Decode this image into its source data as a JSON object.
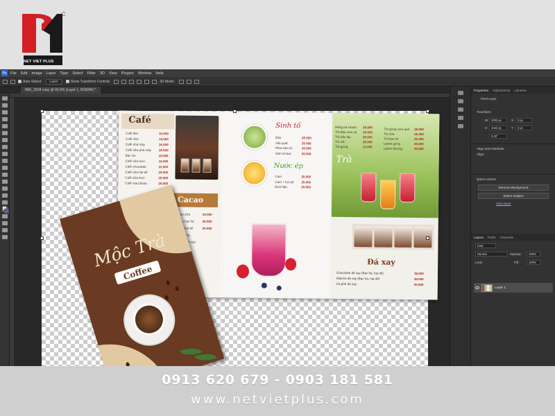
{
  "brand": {
    "logo_text": "NET VIET PLUS",
    "registered": "®",
    "colors": {
      "red": "#d21f26",
      "dark": "#1a1a1a"
    }
  },
  "photoshop": {
    "app_badge": "Ps",
    "menus": [
      "File",
      "Edit",
      "Image",
      "Layer",
      "Type",
      "Select",
      "Filter",
      "3D",
      "View",
      "Plugins",
      "Window",
      "Help"
    ],
    "options": {
      "auto_select": "Auto-Select:",
      "auto_select_value": "Layer",
      "show_transform": "Show Transform Controls",
      "mode_3d": "3D Mode:"
    },
    "document_tab": "IMG_2528 copy @ 66.6% (Layer 1, RGB/8#) *",
    "properties": {
      "tabs": [
        "Properties",
        "Adjustments",
        "Libraries"
      ],
      "kind": "Pixel Layer",
      "transform_title": "Transform",
      "w_label": "W",
      "w_value": "2000 px",
      "h_label": "H",
      "h_value": "1542 px",
      "x_label": "X",
      "x_value": "0 px",
      "y_label": "Y",
      "y_value": "0 px",
      "angle_value": "0.00°",
      "align_title": "Align and Distribute",
      "align_sub": "Align:",
      "quick_title": "Quick Actions",
      "btn_remove_bg": "Remove Background",
      "btn_select_subject": "Select Subject",
      "link_view_more": "View More"
    },
    "layers": {
      "tabs": [
        "Layers",
        "Paths",
        "Channels"
      ],
      "kind": "Kind",
      "blend": "Normal",
      "opacity_label": "Opacity:",
      "opacity_value": "100%",
      "lock_label": "Lock:",
      "fill_label": "Fill:",
      "fill_value": "100%",
      "layer_name": "Layer 1"
    }
  },
  "menu": {
    "cafe_title": "Café",
    "cafe_items": [
      {
        "name": "Cafê đen",
        "price": "15.000"
      },
      {
        "name": "Cafê sữa",
        "price": "18.000"
      },
      {
        "name": "Cafê nhà máy",
        "price": "16.000"
      },
      {
        "name": "Cafê sữa phá máy",
        "price": "16.000"
      },
      {
        "name": "Bạc xỉu",
        "price": "20.000"
      },
      {
        "name": "Cafê sữa tươi",
        "price": "18.000"
      },
      {
        "name": "Cafê chocolate",
        "price": "22.000"
      },
      {
        "name": "Cafê sữa hạt dẻ",
        "price": "25.000"
      },
      {
        "name": "Cafê sữa kem",
        "price": "25.000"
      },
      {
        "name": "Cafê macchiato",
        "price": "25.000"
      }
    ],
    "cacao_title": "Cacao",
    "cacao_items": [
      {
        "name": "Cacao sữa",
        "price": "20.000"
      },
      {
        "name": "Cacao bạc hà",
        "price": "20.000"
      },
      {
        "name": "Cacao hạt dẻ",
        "price": "20.000"
      },
      {
        "name": "Cacao sữa",
        "price": ""
      },
      {
        "name": "Cacao phô mai",
        "price": ""
      }
    ],
    "sinh_to_title": "Sinh tố",
    "sinh_to_items": [
      {
        "name": "Dâu",
        "price": "25.000"
      },
      {
        "name": "Việt quất",
        "price": "25.000"
      },
      {
        "name": "Phúc bồn tử",
        "price": "25.000"
      },
      {
        "name": "Sinh tố kiwi",
        "price": "25.000"
      }
    ],
    "nuoc_ep_title": "Nước ép",
    "nuoc_ep_items": [
      {
        "name": "Cam",
        "price": "25.000"
      },
      {
        "name": "Cam + Cà rốt",
        "price": "25.000"
      },
      {
        "name": "Dưa hấu",
        "price": "25.000"
      }
    ],
    "tra_title": "Trà",
    "tra_items_left": [
      {
        "name": "Hồng trà chanh",
        "price": "20.000"
      },
      {
        "name": "Trà đào cam sả",
        "price": "25.000"
      },
      {
        "name": "Trà dâu tây",
        "price": "25.000"
      },
      {
        "name": "Trà vải",
        "price": "20.000"
      },
      {
        "name": "Trà gừng",
        "price": "12.000"
      }
    ],
    "tra_items_right": [
      {
        "name": "Trà gừng cam quế",
        "price": "25.000"
      },
      {
        "name": "Trà sữa",
        "price": "25.000"
      },
      {
        "name": "Trà bạc hà",
        "price": "25.000"
      },
      {
        "name": "Lipton gừng",
        "price": "25.000"
      },
      {
        "name": "Lipton đường",
        "price": "25.000"
      }
    ],
    "daxay_title": "Đá xay",
    "daxay_items": [
      {
        "name": "Chocolate đá xay (Bạc hà, hạt dẻ)",
        "price": "38.000"
      },
      {
        "name": "Matcha đá xay (Bạc hà, hạt dẻ)",
        "price": "38.000"
      },
      {
        "name": "Cà phê đá xay",
        "price": "30.000"
      }
    ],
    "flyer_title": "Mộc Trà",
    "flyer_badge": "Coffee"
  },
  "footer": {
    "phones": "0913 620 679 - 0903 181 581",
    "website": "www.netvietplus.com"
  }
}
